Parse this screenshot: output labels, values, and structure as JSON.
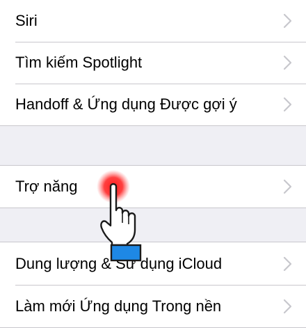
{
  "rows": {
    "siri": "Siri",
    "spotlight": "Tìm kiếm Spotlight",
    "handoff": "Handoff & Ứng dụng Được gợi ý",
    "accessibility": "Trợ năng",
    "storage": "Dung lượng & Sử dụng iCloud",
    "background_refresh": "Làm mới Ứng dụng Trong nền"
  },
  "colors": {
    "background": "#efeff4",
    "cell": "#ffffff",
    "separator": "#c8c7cc",
    "chevron": "#c7c7cc",
    "tap_indicator": "#ff2a2a",
    "cuff": "#1e88e5"
  },
  "icons": {
    "chevron": "chevron-right-icon",
    "pointer": "pointing-hand-icon"
  }
}
